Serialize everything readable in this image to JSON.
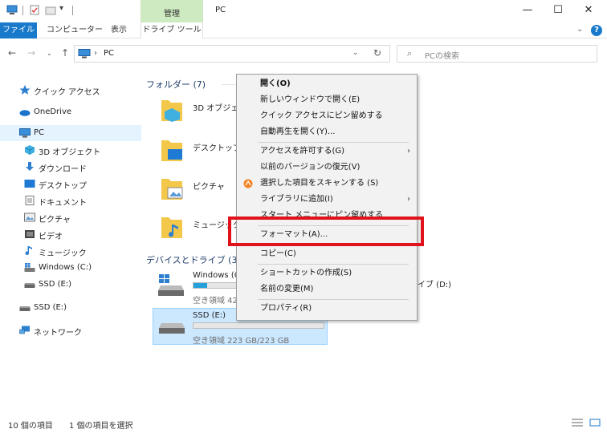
{
  "titlebar": {
    "manage_tab": "管理",
    "title": "PC",
    "minimize": "—",
    "maximize": "☐",
    "close": "✕",
    "quick_access_dropdown": "▾"
  },
  "ribbon": {
    "tabs": [
      {
        "label": "ファイル"
      },
      {
        "label": "コンピューター"
      },
      {
        "label": "表示"
      },
      {
        "label": "ドライブ ツール"
      }
    ],
    "expand": "⌄",
    "help": "?"
  },
  "address": {
    "back": "←",
    "forward": "→",
    "recent": "⌄",
    "up": "↑",
    "separator": "›",
    "path": "PC",
    "dropdown": "⌄",
    "refresh": "↻",
    "search_icon": "⌕",
    "search_placeholder": "PCの検索"
  },
  "sidebar": {
    "items": [
      {
        "label": "クイック アクセス",
        "icon": "star-icon"
      },
      {
        "label": "OneDrive",
        "icon": "cloud-icon"
      },
      {
        "label": "PC",
        "icon": "pc-icon"
      },
      {
        "label": "3D オブジェクト",
        "icon": "3d-objects-icon"
      },
      {
        "label": "ダウンロード",
        "icon": "download-icon"
      },
      {
        "label": "デスクトップ",
        "icon": "desktop-icon"
      },
      {
        "label": "ドキュメント",
        "icon": "document-icon"
      },
      {
        "label": "ピクチャ",
        "icon": "pictures-icon"
      },
      {
        "label": "ビデオ",
        "icon": "video-icon"
      },
      {
        "label": "ミュージック",
        "icon": "music-icon"
      },
      {
        "label": "Windows (C:)",
        "icon": "windows-drive-icon"
      },
      {
        "label": "SSD (E:)",
        "icon": "drive-icon"
      },
      {
        "label": "SSD (E:)",
        "icon": "drive-icon"
      },
      {
        "label": "ネットワーク",
        "icon": "network-icon"
      }
    ]
  },
  "content": {
    "folders_header": "フォルダー (7)",
    "folders": [
      {
        "label": "3D オブジェクト"
      },
      {
        "label": "デスクトップ"
      },
      {
        "label": "ピクチャ"
      },
      {
        "label": "ミュージック"
      }
    ],
    "devices_header": "デバイスとドライブ (3)",
    "drives": [
      {
        "name": "Windows (C",
        "free": "空き領域 42",
        "fill": 0.3
      },
      {
        "name": "SSD (E:)",
        "free": "空き領域 223 GB/223 GB",
        "fill": 0.0
      }
    ],
    "drive_right_label": "イブ (D:)"
  },
  "context_menu": {
    "items": [
      {
        "label": "開く(O)",
        "bold": true
      },
      {
        "label": "新しいウィンドウで開く(E)"
      },
      {
        "label": "クイック アクセスにピン留めする"
      },
      {
        "label": "自動再生を開く(Y)..."
      },
      {
        "label": "アクセスを許可する(G)",
        "submenu": true
      },
      {
        "label": "以前のバージョンの復元(V)"
      },
      {
        "label": "選択した項目をスキャンする (S)",
        "icon": "avast-scan-icon"
      },
      {
        "label": "ライブラリに追加(I)",
        "submenu": true
      },
      {
        "label": "スタート メニューにピン留めする"
      },
      {
        "label": "フォーマット(A)..."
      },
      {
        "label": "コピー(C)"
      },
      {
        "label": "ショートカットの作成(S)"
      },
      {
        "label": "名前の変更(M)"
      },
      {
        "label": "プロパティ(R)"
      }
    ],
    "submenu_arrow": "›",
    "highlight_color": "#e0131d"
  },
  "status": {
    "count": "10 個の項目",
    "selected": "1 個の項目を選択"
  },
  "colors": {
    "accent": "#1979ca",
    "manage_tab": "#cdeac0",
    "selection": "#cce8ff"
  }
}
